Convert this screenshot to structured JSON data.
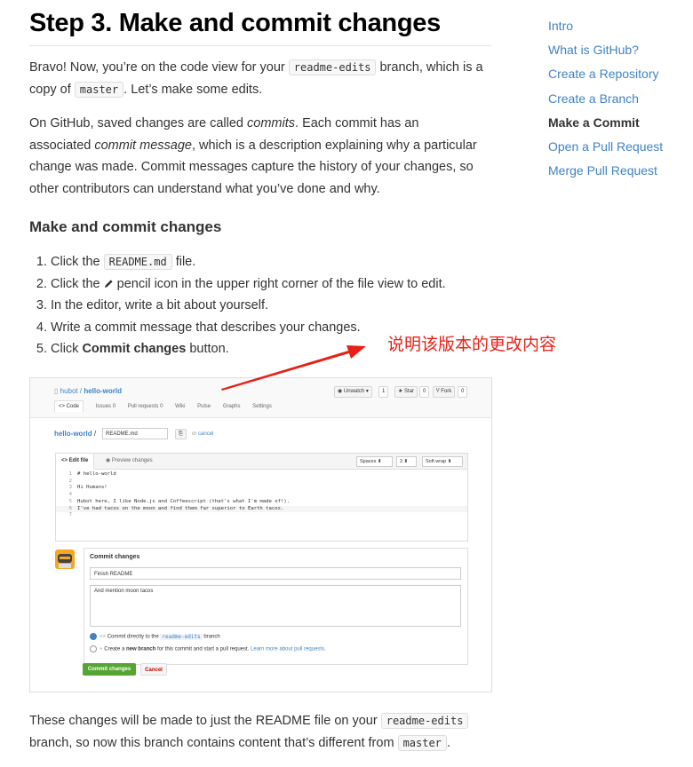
{
  "title": "Step 3. Make and commit changes",
  "intro": {
    "p1_a": "Bravo! Now, you’re on the code view for your ",
    "p1_code1": "readme-edits",
    "p1_b": " branch, which is a copy of ",
    "p1_code2": "master",
    "p1_c": ". Let’s make some edits.",
    "p2_a": "On GitHub, saved changes are called ",
    "p2_em1": "commits",
    "p2_b": ". Each commit has an associated ",
    "p2_em2": "commit message",
    "p2_c": ", which is a description explaining why a particular change was made. Commit messages capture the history of your changes, so other contributors can understand what you’ve done and why."
  },
  "subheading": "Make and commit changes",
  "steps": {
    "s1_a": "Click the ",
    "s1_code": "README.md",
    "s1_b": " file.",
    "s2_a": "Click the ",
    "s2_b": " pencil icon in the upper right corner of the file view to edit.",
    "s3": "In the editor, write a bit about yourself.",
    "s4": "Write a commit message that describes your changes.",
    "s5_a": "Click ",
    "s5_bold": "Commit changes",
    "s5_b": " button."
  },
  "annotation": "说明该版本的更改内容",
  "outro": {
    "a": "These changes will be made to just the README file on your ",
    "code1": "readme-edits",
    "b": " branch, so now this branch contains content that’s different from ",
    "code2": "master",
    "c": "."
  },
  "toc": [
    "Intro",
    "What is GitHub?",
    "Create a Repository",
    "Create a Branch",
    "Make a Commit",
    "Open a Pull Request",
    "Merge Pull Request"
  ],
  "toc_active": "Make a Commit",
  "screenshot": {
    "owner": "hubot",
    "repo": "hello-world",
    "unwatch": "Unwatch ▾",
    "unwatch_count": "1",
    "star": "★ Star",
    "star_count": "0",
    "fork": "Fork",
    "fork_count": "0",
    "tabs": [
      "<> Code",
      "Issues 0",
      "Pull requests 0",
      "Wiki",
      "Pulse",
      "Graphs",
      "Settings"
    ],
    "path_repo": "hello-world",
    "file_name": "README.md",
    "or_text": "or",
    "cancel": "cancel",
    "edit_tab": "<> Edit file",
    "preview_tab": "Preview changes",
    "indent": "Spaces",
    "indent_size": "2",
    "wrap": "Soft wrap",
    "code_lines": [
      {
        "n": "1",
        "t": "# hello-world"
      },
      {
        "n": "2",
        "t": ""
      },
      {
        "n": "3",
        "t": "Hi Humans!"
      },
      {
        "n": "4",
        "t": ""
      },
      {
        "n": "5",
        "t": "Hubot here, I like Node.js and Coffeescript (that's what I'm made of!)."
      },
      {
        "n": "6",
        "t": "I've had tacos on the moon and find them far superior to Earth tacos."
      },
      {
        "n": "7",
        "t": ""
      }
    ],
    "commit_title": "Commit changes",
    "commit_summary": "Finish README",
    "commit_desc": "And mention moon tacos",
    "radio1_a": "Commit directly to the ",
    "radio1_code": "readme-edits",
    "radio1_b": " branch",
    "radio2_a": "Create a ",
    "radio2_bold": "new branch",
    "radio2_b": " for this commit and start a pull request. ",
    "radio2_link": "Learn more about pull requests.",
    "commit_btn": "Commit changes",
    "cancel_btn": "Cancel"
  }
}
